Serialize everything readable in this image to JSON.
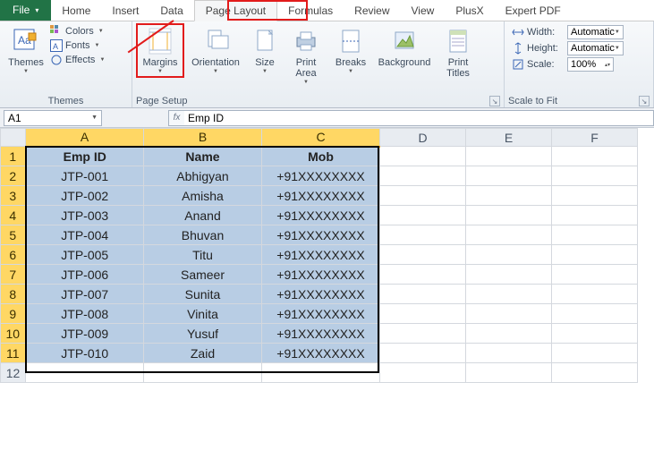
{
  "tabs": {
    "file": "File",
    "list": [
      "Home",
      "Insert",
      "Data",
      "Page Layout",
      "Formulas",
      "Review",
      "View",
      "PlusX",
      "Expert PDF"
    ],
    "active_index": 3
  },
  "ribbon": {
    "themes": {
      "btn": "Themes",
      "colors": "Colors",
      "fonts": "Fonts",
      "effects": "Effects",
      "group_label": "Themes"
    },
    "page_setup": {
      "margins": "Margins",
      "orientation": "Orientation",
      "size": "Size",
      "print_area": "Print\nArea",
      "breaks": "Breaks",
      "background": "Background",
      "print_titles": "Print\nTitles",
      "group_label": "Page Setup"
    },
    "scale": {
      "width_label": "Width:",
      "width_value": "Automatic",
      "height_label": "Height:",
      "height_value": "Automatic",
      "scale_label": "Scale:",
      "scale_value": "100%",
      "group_label": "Scale to Fit"
    }
  },
  "namebox": "A1",
  "formula": "Emp ID",
  "columns": [
    "A",
    "B",
    "C",
    "D",
    "E",
    "F"
  ],
  "headers": {
    "a": "Emp ID",
    "b": "Name",
    "c": "Mob"
  },
  "rows": [
    {
      "n": 1,
      "a": "Emp ID",
      "b": "Name",
      "c": "Mob"
    },
    {
      "n": 2,
      "a": "JTP-001",
      "b": "Abhigyan",
      "c": "+91XXXXXXXX"
    },
    {
      "n": 3,
      "a": "JTP-002",
      "b": "Amisha",
      "c": "+91XXXXXXXX"
    },
    {
      "n": 4,
      "a": "JTP-003",
      "b": "Anand",
      "c": "+91XXXXXXXX"
    },
    {
      "n": 5,
      "a": "JTP-004",
      "b": "Bhuvan",
      "c": "+91XXXXXXXX"
    },
    {
      "n": 6,
      "a": "JTP-005",
      "b": "Titu",
      "c": "+91XXXXXXXX"
    },
    {
      "n": 7,
      "a": "JTP-006",
      "b": "Sameer",
      "c": "+91XXXXXXXX"
    },
    {
      "n": 8,
      "a": "JTP-007",
      "b": "Sunita",
      "c": "+91XXXXXXXX"
    },
    {
      "n": 9,
      "a": "JTP-008",
      "b": "Vinita",
      "c": "+91XXXXXXXX"
    },
    {
      "n": 10,
      "a": "JTP-009",
      "b": "Yusuf",
      "c": "+91XXXXXXXX"
    },
    {
      "n": 11,
      "a": "JTP-010",
      "b": "Zaid",
      "c": "+91XXXXXXXX"
    },
    {
      "n": 12,
      "a": "",
      "b": "",
      "c": ""
    }
  ],
  "highlight": {
    "tab": "Page Layout",
    "button": "Margins"
  }
}
